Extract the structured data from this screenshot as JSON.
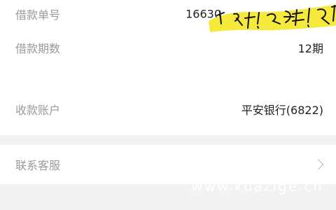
{
  "loan_info": {
    "loan_number_label": "借款单号",
    "loan_number_value": "16630",
    "loan_term_label": "借款期数",
    "loan_term_value": "12期",
    "receiving_account_label": "收款账户",
    "receiving_account_value": "平安银行(6822)"
  },
  "support": {
    "contact_label": "联系客服"
  },
  "overlay": {
    "sticker_text": "多钱!超多钱!超",
    "watermark_text": "www.kuazige.cn"
  },
  "colors": {
    "highlight": "#f5e93c",
    "card": "#ffffff",
    "page": "#f2f2f2"
  },
  "icons": {
    "chevron": "chevron-right-icon"
  }
}
